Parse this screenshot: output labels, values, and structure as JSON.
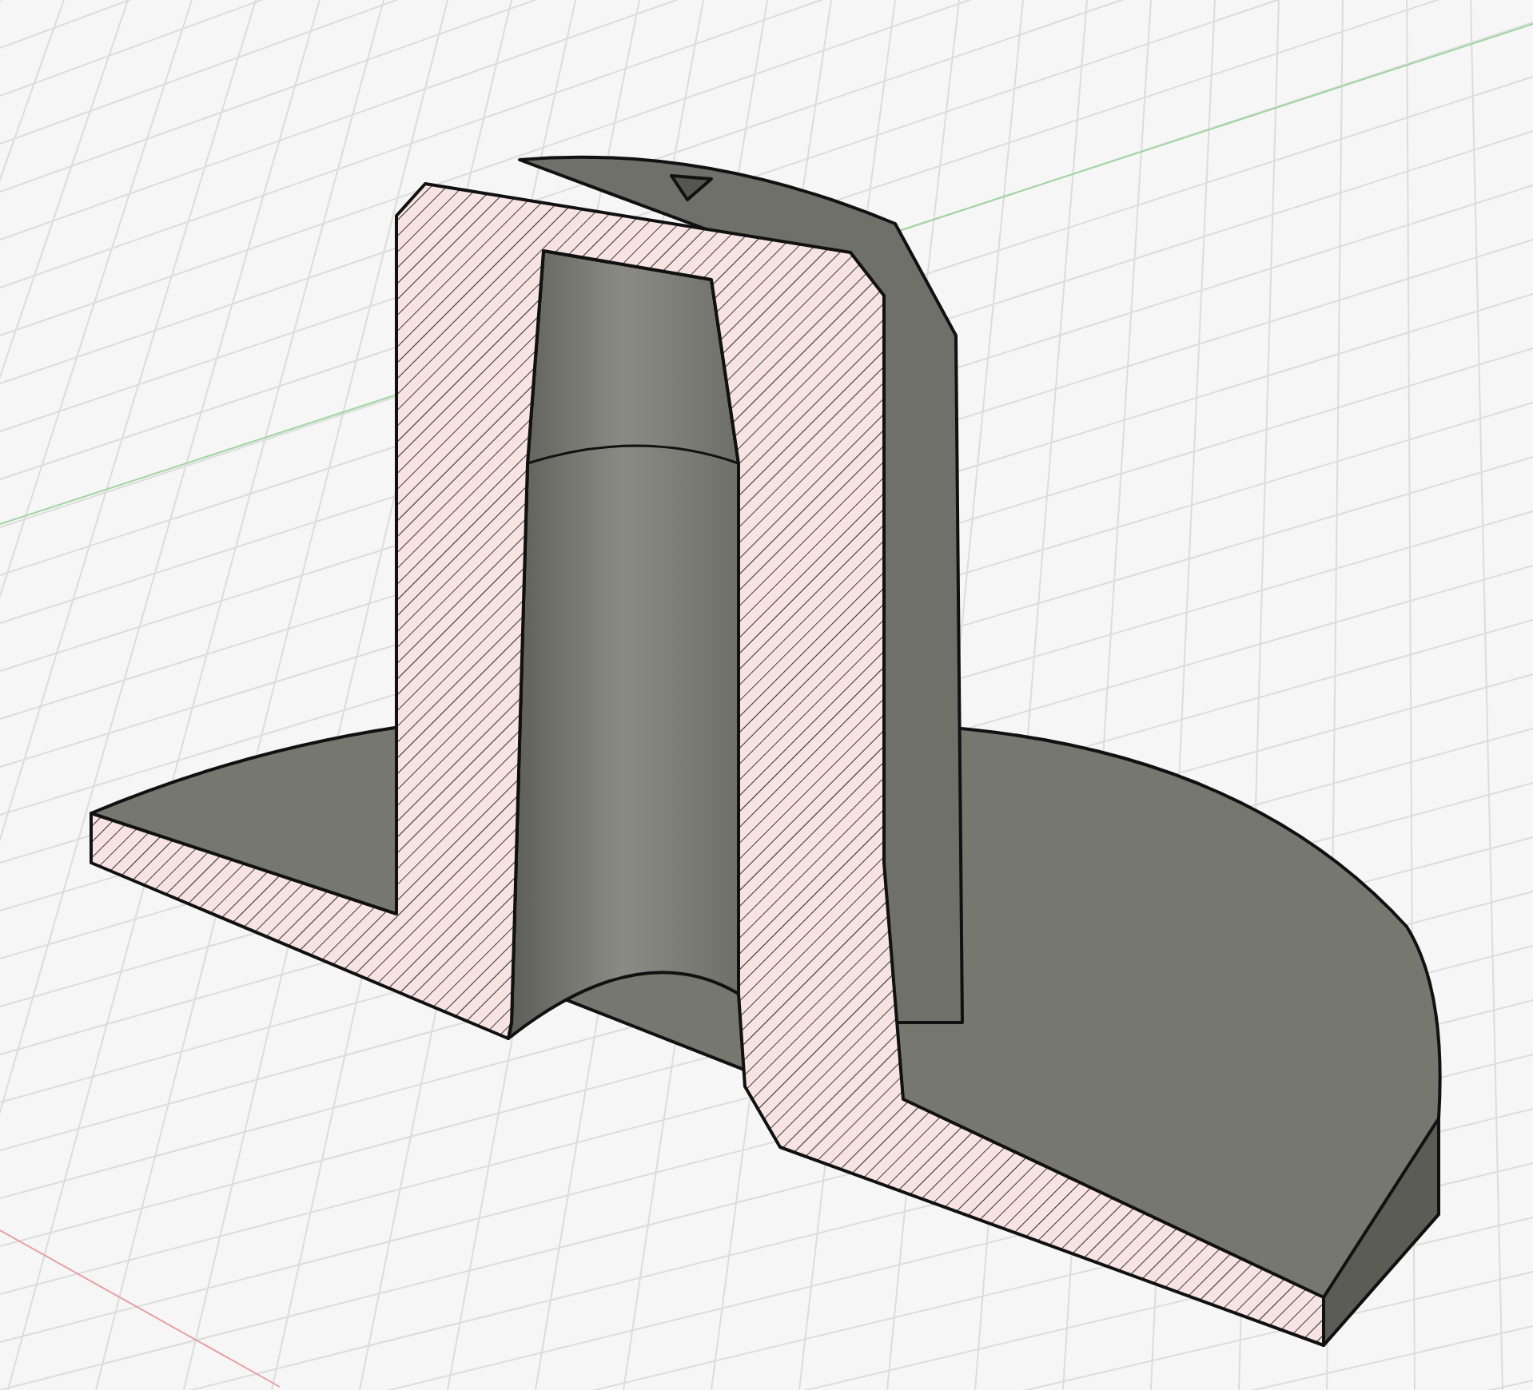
{
  "viewport": {
    "kind": "section-view"
  }
}
